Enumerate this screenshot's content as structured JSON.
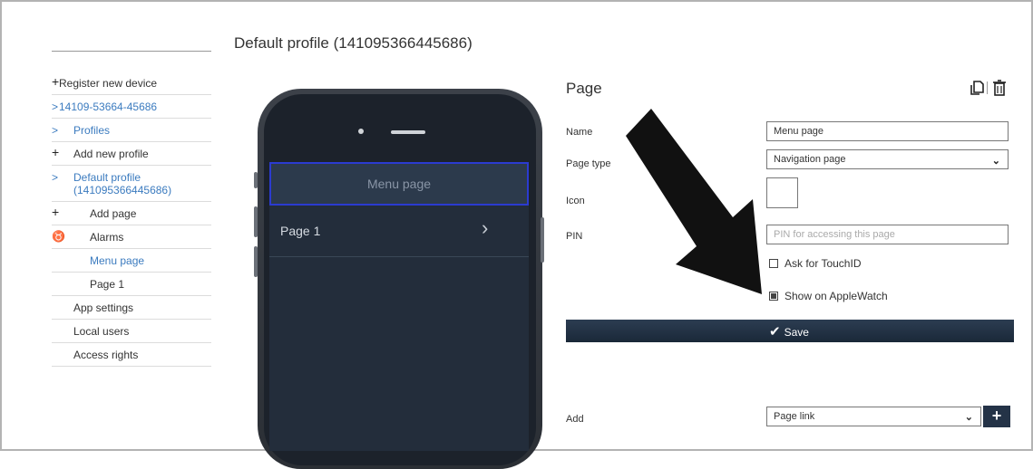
{
  "profile_title": "Default profile (141095366445686)",
  "sidebar": {
    "items": [
      {
        "mark": "+",
        "label": "Register new device",
        "style": "l0"
      },
      {
        "mark": ">",
        "label": "14109-53664-45686",
        "style": "l0 blue"
      },
      {
        "mark": ">",
        "label": "Profiles",
        "style": "l1 blue"
      },
      {
        "mark": "+",
        "label": "Add new profile",
        "style": "l1"
      },
      {
        "mark": ">",
        "label": "Default profile (141095366445686)",
        "style": "l1 blue"
      },
      {
        "mark": "+",
        "label": "Add page",
        "style": "l2"
      },
      {
        "mark": "alarm",
        "label": "Alarms",
        "style": "l2"
      },
      {
        "mark": "",
        "label": "Menu page",
        "style": "l3 blue"
      },
      {
        "mark": "",
        "label": "Page 1",
        "style": "l3"
      },
      {
        "mark": "",
        "label": "App settings",
        "style": "plain"
      },
      {
        "mark": "",
        "label": "Local users",
        "style": "plain"
      },
      {
        "mark": "",
        "label": "Access rights",
        "style": "plain"
      }
    ]
  },
  "phone": {
    "header": "Menu page",
    "rows": [
      {
        "label": "Page 1"
      }
    ]
  },
  "panel": {
    "title": "Page",
    "name_label": "Name",
    "name_value": "Menu page",
    "page_type_label": "Page type",
    "page_type_value": "Navigation page",
    "icon_label": "Icon",
    "pin_label": "PIN",
    "pin_placeholder": "PIN for accessing this page",
    "touchid_label": "Ask for TouchID",
    "touchid_checked": false,
    "applewatch_label": "Show on AppleWatch",
    "applewatch_checked": true,
    "save_label": "Save",
    "add_label": "Add",
    "add_value": "Page link"
  },
  "icons": [
    "copy-icon",
    "trash-icon",
    "alarm-icon",
    "chevron-right-icon",
    "chevron-down-icon",
    "plus-icon",
    "checkmark-icon"
  ],
  "colors": {
    "accent": "#3b7bbf",
    "bar": "#1f2e40",
    "selection": "#2b3bd0"
  }
}
